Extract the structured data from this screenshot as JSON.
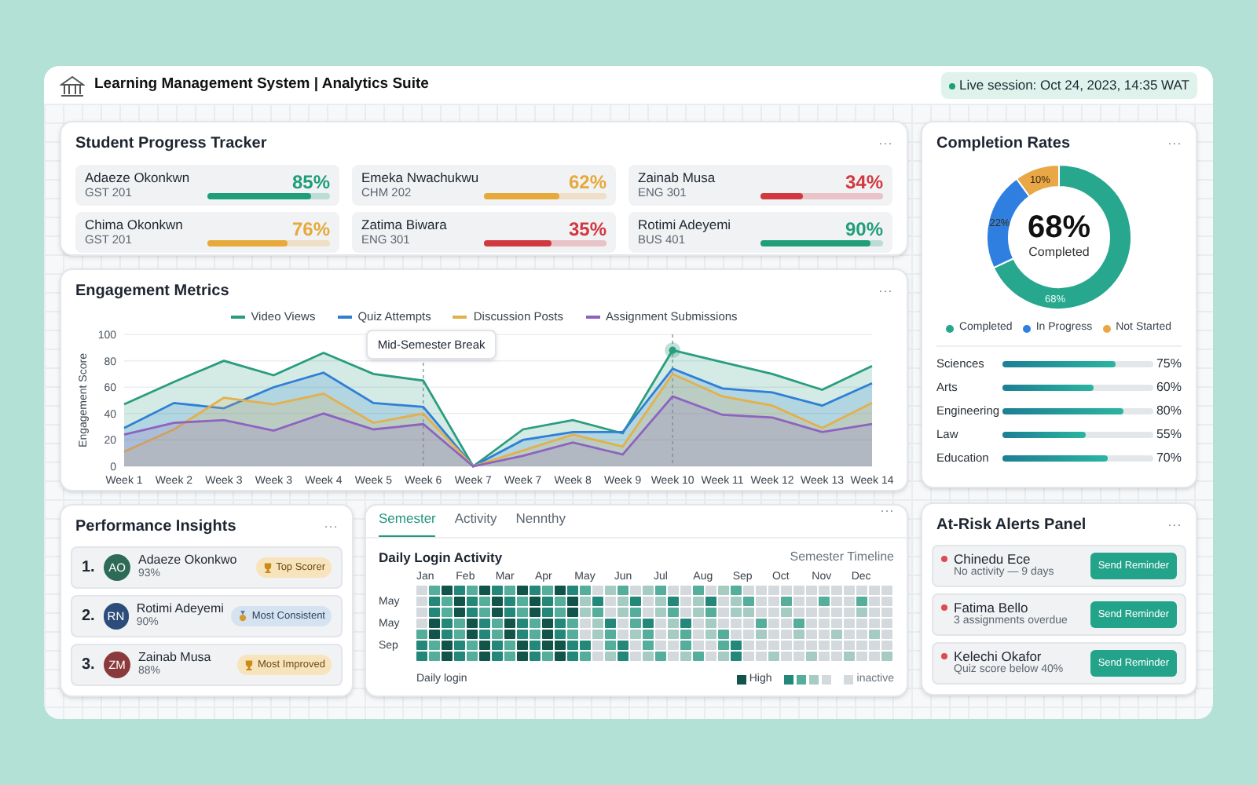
{
  "header": {
    "title": "Learning Management System | Analytics Suite",
    "live_session": "Live session: Oct 24, 2023, 14:35 WAT"
  },
  "progress_tracker": {
    "title": "Student Progress Tracker",
    "menu": "···",
    "students": [
      {
        "name": "Adaeze Okonkwn",
        "course": "GST 201",
        "percent": "85%",
        "level": 0.85,
        "color": "#1f9e7a"
      },
      {
        "name": "Emeka Nwachukwu",
        "course": "CHM 202",
        "percent": "62%",
        "level": 0.62,
        "color": "#e6a93a"
      },
      {
        "name": "Zainab Musa",
        "course": "ENG 301",
        "percent": "34%",
        "level": 0.34,
        "color": "#d0393f"
      },
      {
        "name": "Chima Okonkwn",
        "course": "GST 201",
        "percent": "76%",
        "level": 0.65,
        "color": "#e6a93a"
      },
      {
        "name": "Zatima Biwara",
        "course": "ENG 301",
        "percent": "35%",
        "level": 0.55,
        "color": "#d0393f"
      },
      {
        "name": "Rotimi Adeyemi",
        "course": "BUS 401",
        "percent": "90%",
        "level": 0.9,
        "color": "#1f9e7a"
      }
    ]
  },
  "engagement": {
    "title": "Engagement Metrics",
    "menu": "···",
    "chart_data": {
      "type": "area",
      "ylabel": "Engagement Score",
      "categories": [
        "Week 1",
        "Week 2",
        "Week 3",
        "Week 3",
        "Week 4",
        "Week 5",
        "Week 6",
        "Week 7",
        "Week 7",
        "Week 8",
        "Week 9",
        "Week 10",
        "Week 11",
        "Week 12",
        "Week 13",
        "Week 14"
      ],
      "ylim": [
        0,
        100
      ],
      "yticks": [
        0,
        20,
        40,
        60,
        80,
        100
      ],
      "series": [
        {
          "name": "Video Views",
          "color": "#2a9d7f",
          "values": [
            47,
            64,
            80,
            69,
            86,
            70,
            65,
            0,
            28,
            35,
            25,
            88,
            79,
            70,
            58,
            76
          ]
        },
        {
          "name": "Quiz Attempts",
          "color": "#2f7fd6",
          "values": [
            29,
            48,
            44,
            60,
            71,
            48,
            45,
            0,
            20,
            26,
            26,
            74,
            59,
            56,
            46,
            63
          ]
        },
        {
          "name": "Discussion Posts",
          "color": "#e3b04b",
          "values": [
            11,
            28,
            52,
            47,
            55,
            33,
            40,
            0,
            12,
            24,
            15,
            70,
            53,
            46,
            29,
            48
          ]
        },
        {
          "name": "Assignment Submissions",
          "color": "#8e63c0",
          "values": [
            24,
            33,
            35,
            27,
            40,
            28,
            32,
            0,
            8,
            18,
            9,
            53,
            39,
            37,
            26,
            32
          ]
        }
      ],
      "grid": true,
      "legend": "top",
      "annotations": [
        "Mid-Semester Break"
      ]
    }
  },
  "completion": {
    "title": "Completion Rates",
    "menu": "···",
    "center_value": "68%",
    "center_label": "Completed",
    "chart_data": {
      "type": "donut",
      "categories": [
        "Completed",
        "In Progress",
        "Not Started"
      ],
      "values": [
        68,
        22,
        10
      ],
      "value_labels": [
        "68%",
        "22%",
        "10%"
      ],
      "colors": [
        "#27a78e",
        "#2f7fe0",
        "#e9a845"
      ],
      "legend": "bottom"
    },
    "departments": [
      {
        "name": "Sciences",
        "level": 0.75,
        "percent": "75%"
      },
      {
        "name": "Arts",
        "level": 0.6,
        "percent": "60%"
      },
      {
        "name": "Engineering",
        "level": 0.8,
        "percent": "80%"
      },
      {
        "name": "Law",
        "level": 0.55,
        "percent": "55%"
      },
      {
        "name": "Education",
        "level": 0.7,
        "percent": "70%"
      }
    ]
  },
  "performance": {
    "title": "Performance Insights",
    "menu": "···",
    "rows": [
      {
        "rank": "1.",
        "initials": "AO",
        "color": "#2e6b57",
        "name": "Adaeze Okonkwo",
        "score": "93%",
        "badge": "Top Scorer",
        "kind": "trophy"
      },
      {
        "rank": "2.",
        "initials": "RN",
        "color": "#2c4d7a",
        "name": "Rotimi Adeyemi",
        "score": "90%",
        "badge": "Most Consistent",
        "kind": "medal"
      },
      {
        "rank": "3.",
        "initials": "ZM",
        "color": "#8a3a3c",
        "name": "Zainab Musa",
        "score": "88%",
        "badge": "Most Improved",
        "kind": "trophy"
      }
    ]
  },
  "activity": {
    "tabs": [
      {
        "label": "Semester",
        "selected": true
      },
      {
        "label": "Activity",
        "selected": false
      },
      {
        "label": "Nennthy",
        "selected": false
      }
    ],
    "menu": "···",
    "title": "Daily Login Activity",
    "subtitle": "Semester Timeline",
    "months": [
      "Jan",
      "Feb",
      "Mar",
      "Apr",
      "May",
      "Jun",
      "Jul",
      "Aug",
      "Sep",
      "Oct",
      "Nov",
      "Dec"
    ],
    "row_labels": [
      "May",
      "May",
      "Sep"
    ],
    "footer": "Daily login",
    "legend_high": "High",
    "legend_inactive": "inactive"
  },
  "alerts": {
    "title": "At-Risk Alerts Panel",
    "menu": "···",
    "items": [
      {
        "name": "Chinedu Ece",
        "detail": "No activity — 9 days",
        "button": "Send Reminder"
      },
      {
        "name": "Fatima Bello",
        "detail": "3 assignments overdue",
        "button": "Send Reminder"
      },
      {
        "name": "Kelechi Okafor",
        "detail": "Quiz score below 40%",
        "button": "Send Reminder"
      }
    ]
  }
}
